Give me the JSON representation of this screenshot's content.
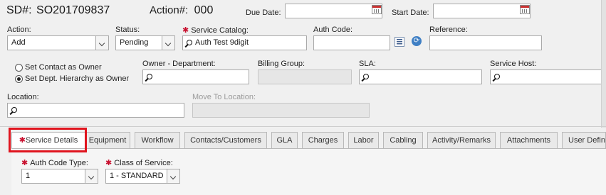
{
  "header": {
    "sd_label": "SD#:",
    "sd_value": "SO201709837",
    "action_label": "Action#:",
    "action_value": "000",
    "due_date_label": "Due Date:",
    "due_date_value": "",
    "start_date_label": "Start Date:",
    "start_date_value": ""
  },
  "row1": {
    "action_label": "Action:",
    "action_value": "Add",
    "status_label": "Status:",
    "status_value": "Pending",
    "service_catalog_label": "Service Catalog:",
    "service_catalog_value": "Auth Test 9digit",
    "auth_code_label": "Auth Code:",
    "auth_code_value": "",
    "reference_label": "Reference:",
    "reference_value": ""
  },
  "row2": {
    "radio_contact_label": "Set Contact as Owner",
    "radio_dept_label": "Set Dept. Hierarchy as Owner",
    "owner_dept_label": "Owner - Department:",
    "billing_group_label": "Billing Group:",
    "sla_label": "SLA:",
    "service_host_label": "Service Host:"
  },
  "row3": {
    "location_label": "Location:",
    "move_to_location_label": "Move To Location:"
  },
  "tabs": [
    {
      "label": "Service Details"
    },
    {
      "label": "Equipment"
    },
    {
      "label": "Workflow"
    },
    {
      "label": "Contacts/Customers"
    },
    {
      "label": "GLA"
    },
    {
      "label": "Charges"
    },
    {
      "label": "Labor"
    },
    {
      "label": "Cabling"
    },
    {
      "label": "Activity/Remarks"
    },
    {
      "label": "Attachments"
    },
    {
      "label": "User Define"
    }
  ],
  "details": {
    "auth_code_type_label": "Auth Code Type:",
    "auth_code_type_value": "1",
    "class_of_service_label": "Class of Service:",
    "class_of_service_value": "1 - STANDARD"
  },
  "colors": {
    "required": "#c8102e",
    "highlight": "#e0141e"
  }
}
